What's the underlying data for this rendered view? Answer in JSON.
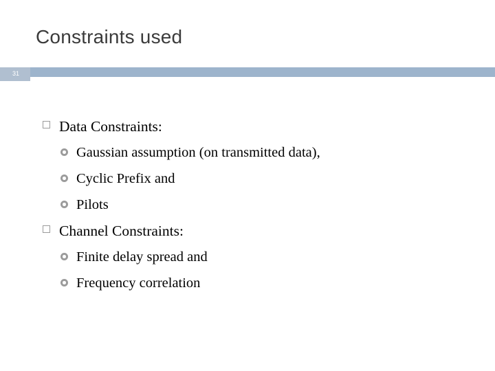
{
  "slide": {
    "title": "Constraints used",
    "number": "31",
    "accent_color": "#9db4cc",
    "number_box_color": "#b0bfd0",
    "title_color": "#3b3b3b",
    "bullets": [
      {
        "level": 1,
        "marker": "square-outline-bullet",
        "text": "Data Constraints:"
      },
      {
        "level": 2,
        "marker": "ring-bullet",
        "text": "Gaussian assumption (on transmitted data),"
      },
      {
        "level": 2,
        "marker": "ring-bullet",
        "text": "Cyclic Prefix and"
      },
      {
        "level": 2,
        "marker": "ring-bullet",
        "text": "Pilots"
      },
      {
        "level": 1,
        "marker": "square-outline-bullet",
        "text": "Channel Constraints:"
      },
      {
        "level": 2,
        "marker": "ring-bullet",
        "text": "Finite delay spread and"
      },
      {
        "level": 2,
        "marker": "ring-bullet",
        "text": "Frequency correlation"
      }
    ]
  }
}
